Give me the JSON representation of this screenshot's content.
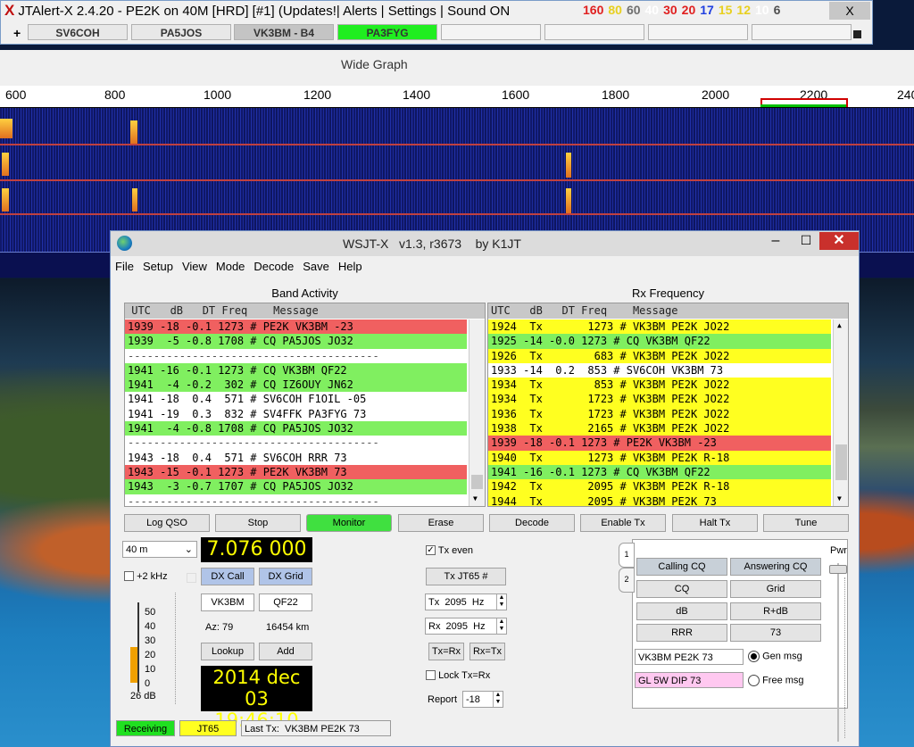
{
  "jtalert": {
    "title": "JTAlert-X 2.4.20 - PE2K on 40M [HRD] [#1] (Updates!| Alerts | Settings | Sound ON",
    "counts": [
      {
        "value": "160",
        "color": "#e02020"
      },
      {
        "value": "80",
        "color": "#e8d020"
      },
      {
        "value": "60",
        "color": "#707070"
      },
      {
        "value": "40",
        "color": "#ffffff"
      },
      {
        "value": "30",
        "color": "#e02020"
      },
      {
        "value": "20",
        "color": "#e02020"
      },
      {
        "value": "17",
        "color": "#2040e0"
      },
      {
        "value": "15",
        "color": "#e8d020"
      },
      {
        "value": "12",
        "color": "#e8d020"
      },
      {
        "value": "10",
        "color": "#ffffff"
      },
      {
        "value": "6",
        "color": "#505050"
      }
    ],
    "close": "X",
    "plus": "+",
    "callsigns": [
      {
        "label": "SV6COH",
        "bg": "#e8e8e8"
      },
      {
        "label": "PA5JOS",
        "bg": "#e8e8e8"
      },
      {
        "label": "VK3BM - B4",
        "bg": "#c4c4c4"
      },
      {
        "label": "PA3FYG",
        "bg": "#20ee20"
      },
      {
        "label": "",
        "bg": "#f4f4f4"
      },
      {
        "label": "",
        "bg": "#f4f4f4"
      },
      {
        "label": "",
        "bg": "#f4f4f4"
      },
      {
        "label": "",
        "bg": "#f4f4f4"
      }
    ]
  },
  "wide_graph": {
    "title": "Wide Graph",
    "ticks": [
      "600",
      "800",
      "1000",
      "1200",
      "1400",
      "1600",
      "1800",
      "2000",
      "2200",
      "240"
    ]
  },
  "wsjtx": {
    "title": "WSJT-X   v1.3, r3673    by K1JT",
    "menu": [
      "File",
      "Setup",
      "View",
      "Mode",
      "Decode",
      "Save",
      "Help"
    ],
    "band_activity": {
      "title": "Band Activity",
      "header": " UTC   dB   DT Freq    Message",
      "rows": [
        {
          "text": "1939 -18 -0.1 1273 # PE2K VK3BM -23",
          "color": "red"
        },
        {
          "text": "1939  -5 -0.8 1708 # CQ PA5JOS JO32",
          "color": "green"
        },
        {
          "text": "---------------------------------------",
          "color": "sep"
        },
        {
          "text": "1941 -16 -0.1 1273 # CQ VK3BM QF22",
          "color": "green"
        },
        {
          "text": "1941  -4 -0.2  302 # CQ IZ6OUY JN62",
          "color": "green"
        },
        {
          "text": "1941 -18  0.4  571 # SV6COH F1OIL -05",
          "color": "white"
        },
        {
          "text": "1941 -19  0.3  832 # SV4FFK PA3FYG 73",
          "color": "white"
        },
        {
          "text": "1941  -4 -0.8 1708 # CQ PA5JOS JO32",
          "color": "green"
        },
        {
          "text": "---------------------------------------",
          "color": "sep"
        },
        {
          "text": "1943 -18  0.4  571 # SV6COH RRR 73",
          "color": "white"
        },
        {
          "text": "1943 -15 -0.1 1273 # PE2K VK3BM 73",
          "color": "red"
        },
        {
          "text": "1943  -3 -0.7 1707 # CQ PA5JOS JO32",
          "color": "green"
        },
        {
          "text": "---------------------------------------",
          "color": "sep"
        }
      ]
    },
    "rx_frequency": {
      "title": "Rx Frequency",
      "header": "UTC   dB   DT Freq    Message",
      "rows": [
        {
          "text": "1924  Tx       1273 # VK3BM PE2K JO22",
          "color": "yellow"
        },
        {
          "text": "1925 -14 -0.0 1273 # CQ VK3BM QF22",
          "color": "green"
        },
        {
          "text": "1926  Tx        683 # VK3BM PE2K JO22",
          "color": "yellow"
        },
        {
          "text": "1933 -14  0.2  853 # SV6COH VK3BM 73",
          "color": "white"
        },
        {
          "text": "1934  Tx        853 # VK3BM PE2K JO22",
          "color": "yellow"
        },
        {
          "text": "1934  Tx       1723 # VK3BM PE2K JO22",
          "color": "yellow"
        },
        {
          "text": "1936  Tx       1723 # VK3BM PE2K JO22",
          "color": "yellow"
        },
        {
          "text": "1938  Tx       2165 # VK3BM PE2K JO22",
          "color": "yellow"
        },
        {
          "text": "1939 -18 -0.1 1273 # PE2K VK3BM -23",
          "color": "red"
        },
        {
          "text": "1940  Tx       1273 # VK3BM PE2K R-18",
          "color": "yellow"
        },
        {
          "text": "1941 -16 -0.1 1273 # CQ VK3BM QF22",
          "color": "green"
        },
        {
          "text": "1942  Tx       2095 # VK3BM PE2K R-18",
          "color": "yellow"
        },
        {
          "text": "1944  Tx       2095 # VK3BM PE2K 73",
          "color": "yellow"
        }
      ]
    },
    "buttons": {
      "log_qso": "Log QSO",
      "stop": "Stop",
      "monitor": "Monitor",
      "erase": "Erase",
      "decode": "Decode",
      "enable_tx": "Enable Tx",
      "halt_tx": "Halt Tx",
      "tune": "Tune"
    },
    "band": "40 m",
    "dial_freq": "7.076 000",
    "plus2khz": "+2 kHz",
    "dx_call_btn": "DX Call",
    "dx_grid_btn": "DX Grid",
    "dx_call": "VK3BM",
    "dx_grid": "QF22",
    "az": "Az: 79",
    "dist": "16454 km",
    "lookup": "Lookup",
    "add": "Add",
    "date": "2014 dec 03",
    "time": "19:46:10",
    "meter_scale": [
      "50",
      "40",
      "30",
      "20",
      "10",
      "0"
    ],
    "meter_level": 0.5,
    "meter_db": "26 dB",
    "tx_even": "Tx even",
    "tx_mode": "Tx JT65  #",
    "tx_freq": "Tx  2095  Hz",
    "rx_freq": "Rx  2095  Hz",
    "tx_eq_rx": "Tx=Rx",
    "rx_eq_tx": "Rx=Tx",
    "lock": "Lock Tx=Rx",
    "report_label": "Report",
    "report": "-18",
    "tab1": "1",
    "tab2": "2",
    "calling_cq": "Calling CQ",
    "answering_cq": "Answering CQ",
    "cq": "CQ",
    "grid": "Grid",
    "db": "dB",
    "rdb": "R+dB",
    "rrr": "RRR",
    "b73": "73",
    "gen_text": "VK3BM PE2K 73",
    "free_text": "GL 5W DIP 73",
    "gen_msg": "Gen msg",
    "free_msg": "Free msg",
    "pwr": "Pwr",
    "status": {
      "receiving": "Receiving",
      "mode": "JT65",
      "last_tx": "Last Tx:  VK3BM PE2K 73"
    }
  }
}
